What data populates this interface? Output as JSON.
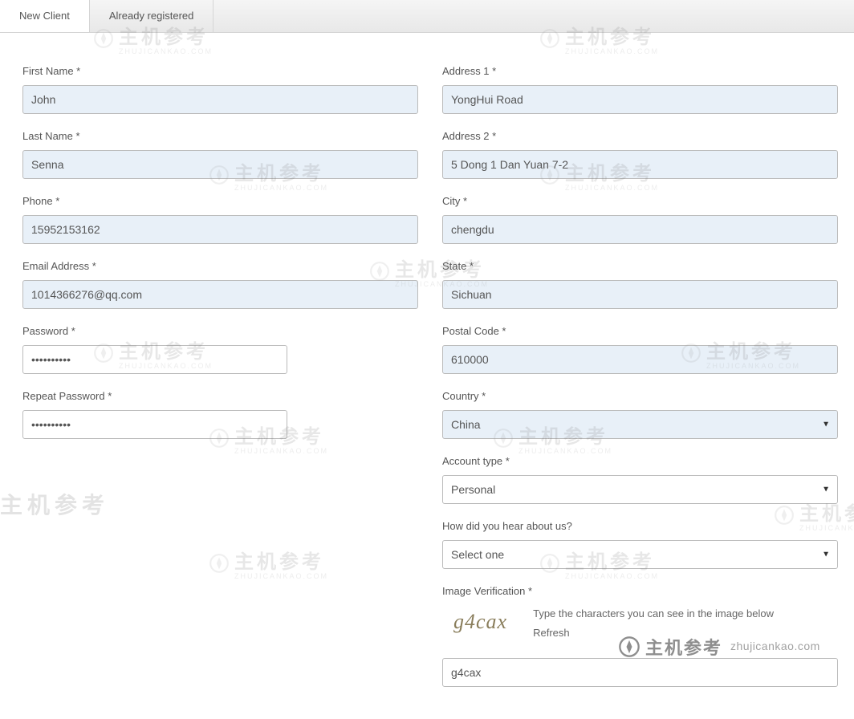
{
  "tabs": {
    "new_client": "New Client",
    "already_registered": "Already registered"
  },
  "left": {
    "first_name_label": "First Name *",
    "first_name_value": "John",
    "last_name_label": "Last Name *",
    "last_name_value": "Senna",
    "phone_label": "Phone *",
    "phone_value": "15952153162",
    "email_label": "Email Address *",
    "email_value": "1014366276@qq.com",
    "password_label": "Password *",
    "password_value": "••••••••••",
    "repeat_password_label": "Repeat Password *",
    "repeat_password_value": "••••••••••"
  },
  "right": {
    "address1_label": "Address 1 *",
    "address1_value": "YongHui Road",
    "address2_label": "Address 2 *",
    "address2_value": "5 Dong 1 Dan Yuan 7-2",
    "city_label": "City *",
    "city_value": "chengdu",
    "state_label": "State *",
    "state_value": "Sichuan",
    "postal_label": "Postal Code *",
    "postal_value": "610000",
    "country_label": "Country *",
    "country_value": "China",
    "account_type_label": "Account type *",
    "account_type_value": "Personal",
    "hear_label": "How did you hear about us?",
    "hear_value": "Select one",
    "verify_label": "Image Verification *",
    "verify_captcha": "g4cax",
    "verify_hint": "Type the characters you can see in the image below",
    "verify_refresh": "Refresh",
    "verify_value": "g4cax"
  },
  "watermark": {
    "main": "主机参考",
    "sub": "ZHUJICANKAO.COM",
    "domain": "zhujicankao.com"
  }
}
